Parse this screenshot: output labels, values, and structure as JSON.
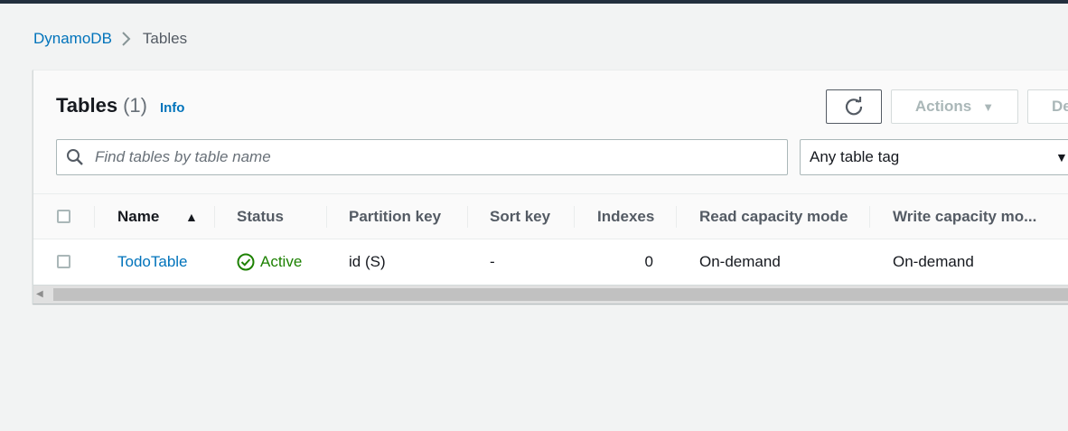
{
  "breadcrumb": {
    "root": "DynamoDB",
    "current": "Tables"
  },
  "header": {
    "title": "Tables",
    "count": "(1)",
    "info": "Info",
    "actions_label": "Actions",
    "delete_label": "De"
  },
  "search": {
    "placeholder": "Find tables by table name",
    "value": ""
  },
  "tag_filter": {
    "selected": "Any table tag"
  },
  "table": {
    "columns": [
      "Name",
      "Status",
      "Partition key",
      "Sort key",
      "Indexes",
      "Read capacity mode",
      "Write capacity mo..."
    ],
    "sort_indicator": "▲",
    "rows": [
      {
        "name": "TodoTable",
        "status": "Active",
        "partition_key": "id (S)",
        "sort_key": "-",
        "indexes": "0",
        "read_capacity_mode": "On-demand",
        "write_capacity_mode": "On-demand"
      }
    ]
  },
  "colors": {
    "link": "#0073bb",
    "success": "#1d8102",
    "topbar": "#232f3e"
  }
}
